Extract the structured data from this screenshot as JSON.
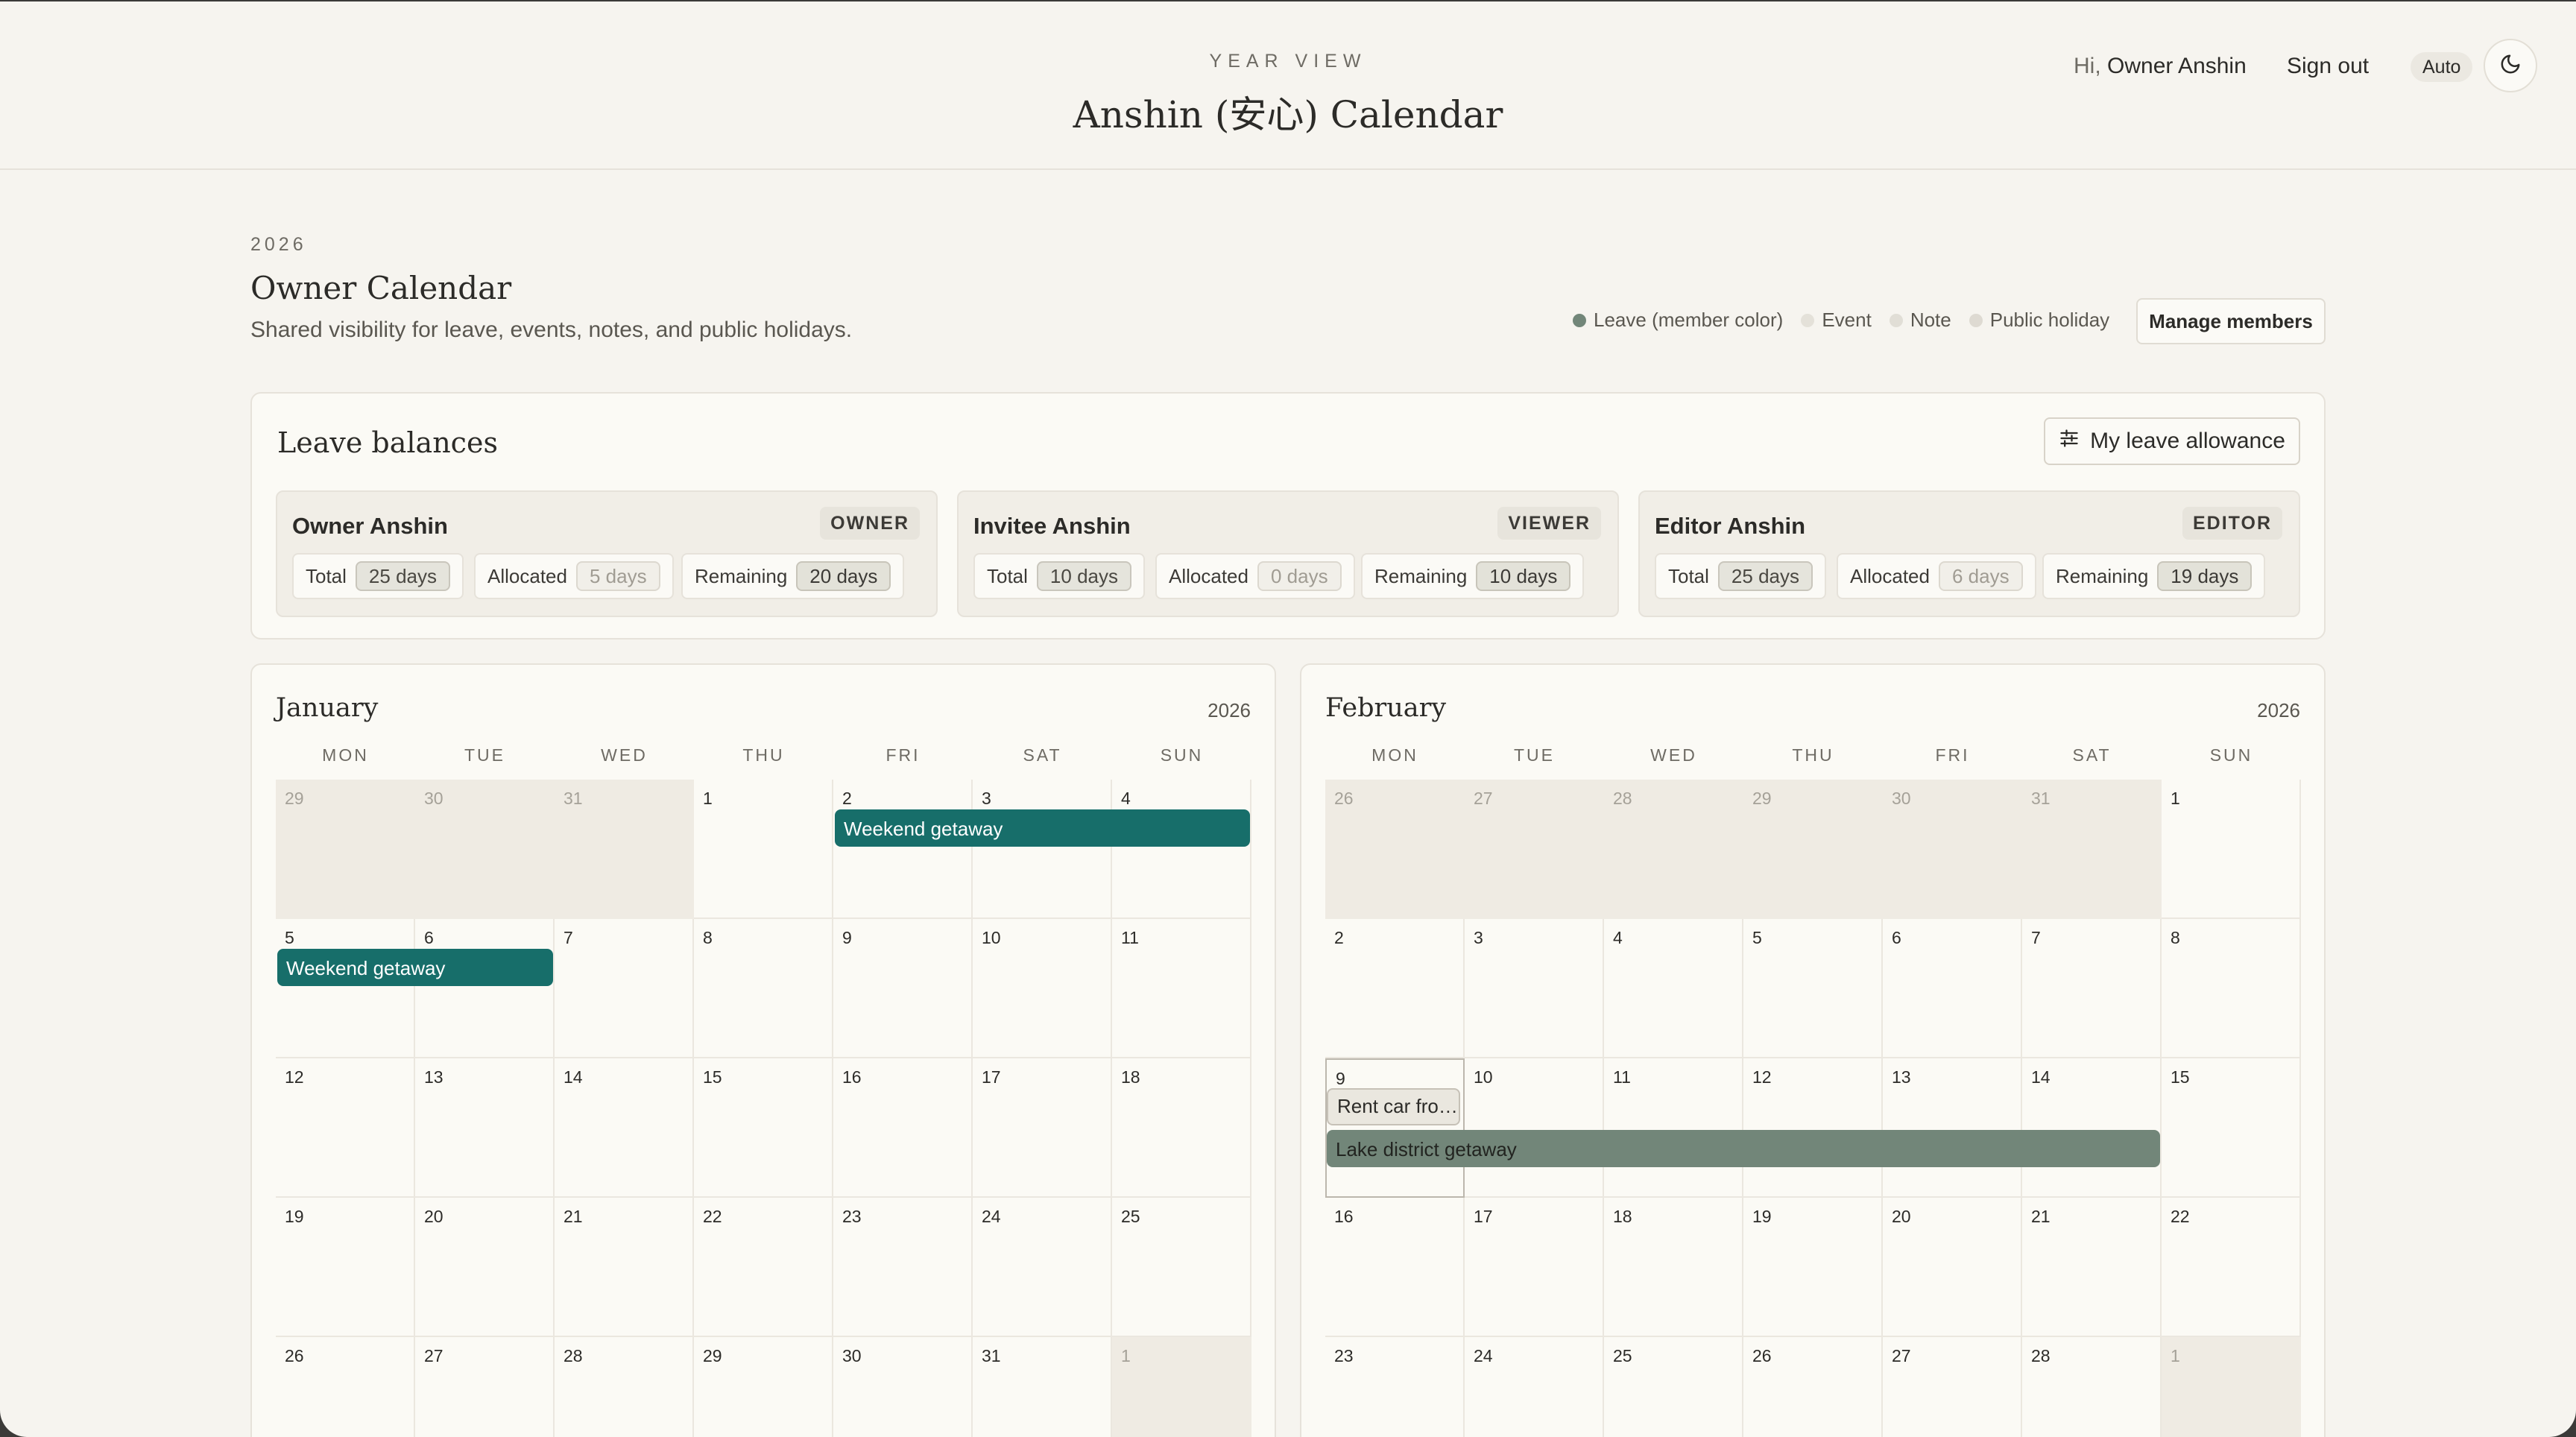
{
  "header": {
    "eyebrow": "YEAR VIEW",
    "title": "Anshin (安心) Calendar",
    "greeting_prefix": "Hi,",
    "user_name": "Owner Anshin",
    "sign_out": "Sign out",
    "theme_mode": "Auto",
    "theme_icon": "moon-icon"
  },
  "page": {
    "year": "2026",
    "title": "Owner Calendar",
    "subtitle": "Shared visibility for leave, events, notes, and public holidays."
  },
  "legend": [
    {
      "label": "Leave (member color)",
      "color": "#728679"
    },
    {
      "label": "Event",
      "color": "#e4e1d9"
    },
    {
      "label": "Note",
      "color": "#e1ded6"
    },
    {
      "label": "Public holiday",
      "color": "#dedad2"
    }
  ],
  "manage_members": "Manage members",
  "balances": {
    "title": "Leave balances",
    "allowance_button": "My leave allowance",
    "members": [
      {
        "name": "Owner Anshin",
        "role": "OWNER",
        "total_label": "Total",
        "total": "25 days",
        "allocated_label": "Allocated",
        "allocated": "5 days",
        "remaining_label": "Remaining",
        "remaining": "20 days"
      },
      {
        "name": "Invitee Anshin",
        "role": "VIEWER",
        "total_label": "Total",
        "total": "10 days",
        "allocated_label": "Allocated",
        "allocated": "0 days",
        "remaining_label": "Remaining",
        "remaining": "10 days"
      },
      {
        "name": "Editor Anshin",
        "role": "EDITOR",
        "total_label": "Total",
        "total": "25 days",
        "allocated_label": "Allocated",
        "allocated": "6 days",
        "remaining_label": "Remaining",
        "remaining": "19 days"
      }
    ]
  },
  "weekdays": [
    "MON",
    "TUE",
    "WED",
    "THU",
    "FRI",
    "SAT",
    "SUN"
  ],
  "months": [
    {
      "name": "January",
      "year": "2026",
      "days": [
        {
          "d": "29",
          "out": true
        },
        {
          "d": "30",
          "out": true
        },
        {
          "d": "31",
          "out": true
        },
        {
          "d": "1"
        },
        {
          "d": "2"
        },
        {
          "d": "3"
        },
        {
          "d": "4"
        },
        {
          "d": "5"
        },
        {
          "d": "6"
        },
        {
          "d": "7"
        },
        {
          "d": "8"
        },
        {
          "d": "9"
        },
        {
          "d": "10"
        },
        {
          "d": "11"
        },
        {
          "d": "12"
        },
        {
          "d": "13"
        },
        {
          "d": "14"
        },
        {
          "d": "15"
        },
        {
          "d": "16"
        },
        {
          "d": "17"
        },
        {
          "d": "18"
        },
        {
          "d": "19"
        },
        {
          "d": "20"
        },
        {
          "d": "21"
        },
        {
          "d": "22"
        },
        {
          "d": "23"
        },
        {
          "d": "24"
        },
        {
          "d": "25"
        },
        {
          "d": "26"
        },
        {
          "d": "27"
        },
        {
          "d": "28"
        },
        {
          "d": "29"
        },
        {
          "d": "30"
        },
        {
          "d": "31"
        },
        {
          "d": "1",
          "out": true
        }
      ],
      "events": [
        {
          "label": "Weekend getaway",
          "kind": "leave",
          "color": "#176e6a",
          "start_day": "2",
          "end_day": "4"
        },
        {
          "label": "Weekend getaway",
          "kind": "leave",
          "color": "#176e6a",
          "start_day": "5",
          "end_day": "6"
        }
      ]
    },
    {
      "name": "February",
      "year": "2026",
      "days": [
        {
          "d": "26",
          "out": true
        },
        {
          "d": "27",
          "out": true
        },
        {
          "d": "28",
          "out": true
        },
        {
          "d": "29",
          "out": true
        },
        {
          "d": "30",
          "out": true
        },
        {
          "d": "31",
          "out": true
        },
        {
          "d": "1"
        },
        {
          "d": "2"
        },
        {
          "d": "3"
        },
        {
          "d": "4"
        },
        {
          "d": "5"
        },
        {
          "d": "6"
        },
        {
          "d": "7"
        },
        {
          "d": "8"
        },
        {
          "d": "9",
          "sel": true
        },
        {
          "d": "10"
        },
        {
          "d": "11"
        },
        {
          "d": "12"
        },
        {
          "d": "13"
        },
        {
          "d": "14"
        },
        {
          "d": "15"
        },
        {
          "d": "16"
        },
        {
          "d": "17"
        },
        {
          "d": "18"
        },
        {
          "d": "19"
        },
        {
          "d": "20"
        },
        {
          "d": "21"
        },
        {
          "d": "22"
        },
        {
          "d": "23"
        },
        {
          "d": "24"
        },
        {
          "d": "25"
        },
        {
          "d": "26"
        },
        {
          "d": "27"
        },
        {
          "d": "28"
        },
        {
          "d": "1",
          "out": true
        }
      ],
      "events": [
        {
          "label": "Rent car fro…",
          "kind": "event",
          "color": "#eae7df",
          "start_day": "9",
          "end_day": "9"
        },
        {
          "label": "Lake district getaway",
          "kind": "leave",
          "color": "#728679",
          "start_day": "9",
          "end_day": "14"
        }
      ]
    }
  ]
}
